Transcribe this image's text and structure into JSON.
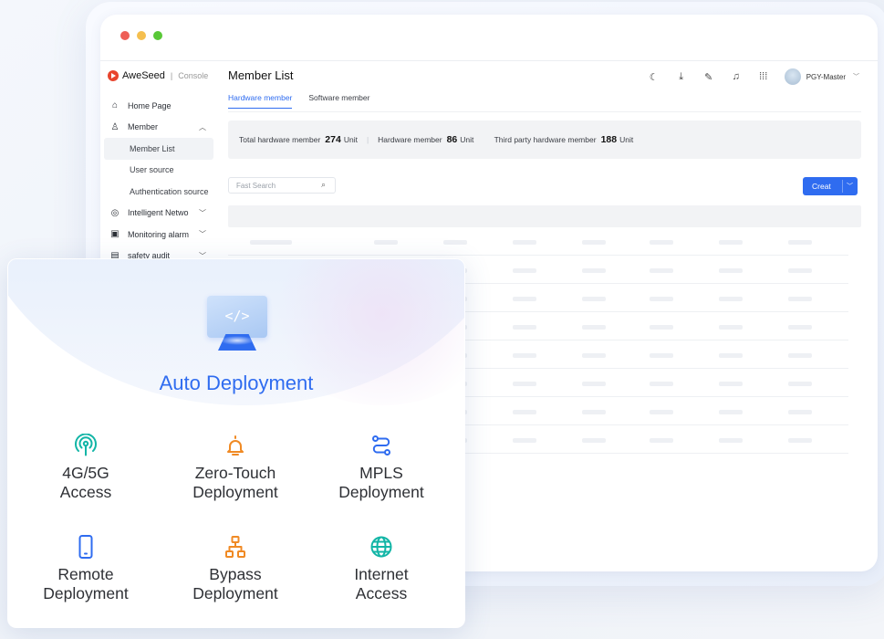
{
  "window": {
    "traffic_lights": [
      "#ee5f57",
      "#f5bf4f",
      "#59c837"
    ]
  },
  "brand": {
    "name": "AweSeed",
    "product": "Console",
    "logo_color": "#e8442d"
  },
  "sidebar": {
    "items": [
      {
        "label": "Home Page",
        "icon": "home-icon"
      },
      {
        "label": "Member",
        "icon": "user-icon",
        "expanded": true
      },
      {
        "label": "Member List",
        "sub": true,
        "active": true
      },
      {
        "label": "User source",
        "sub": true
      },
      {
        "label": "Authentication source",
        "sub": true
      },
      {
        "label": "Intelligent Netwo",
        "icon": "network-icon"
      },
      {
        "label": "Monitoring alarm",
        "icon": "monitor-icon"
      },
      {
        "label": "safety audit",
        "icon": "audit-icon"
      }
    ]
  },
  "header": {
    "title": "Member List",
    "icons": [
      "moon-icon",
      "download-icon",
      "edit-icon",
      "bell-icon",
      "apps-grid-icon"
    ],
    "user": "PGY-Master"
  },
  "tabs": [
    {
      "label": "Hardware member",
      "active": true
    },
    {
      "label": "Software member",
      "active": false
    }
  ],
  "stats": {
    "total_label": "Total hardware member",
    "total_value": "274",
    "total_unit": "Unit",
    "hw_label": "Hardware member",
    "hw_value": "86",
    "hw_unit": "Unit",
    "third_label": "Third party hardware member",
    "third_value": "188",
    "third_unit": "Unit"
  },
  "search": {
    "placeholder": "Fast Search"
  },
  "create_button": {
    "label": "Creat"
  },
  "accent": "#2f6cf0",
  "card": {
    "title": "Auto Deployment",
    "features": [
      {
        "label": "4G/5G\nAccess",
        "icon": "antenna-icon",
        "color": "#12b5a6"
      },
      {
        "label": "Zero-Touch\nDeployment",
        "icon": "bell-hand-icon",
        "color": "#f08a24"
      },
      {
        "label": "MPLS\nDeployment",
        "icon": "route-icon",
        "color": "#2f6cf0"
      },
      {
        "label": "Remote\nDeployment",
        "icon": "phone-icon",
        "color": "#2f6cf0"
      },
      {
        "label": "Bypass\nDeployment",
        "icon": "topology-icon",
        "color": "#f08a24"
      },
      {
        "label": "Internet\nAccess",
        "icon": "globe-icon",
        "color": "#12b5a6"
      }
    ]
  }
}
